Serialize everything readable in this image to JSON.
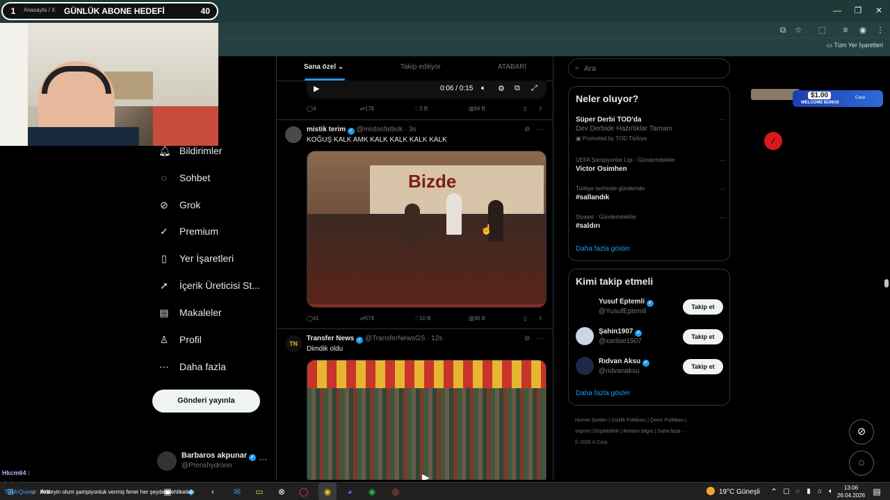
{
  "browser": {
    "tab_title": "Anasayfa / X",
    "bookmarks_label": "Tüm Yer İşaretleri"
  },
  "goal_overlay": {
    "number": "1",
    "title": "GÜNLÜK ABONE HEDEFİ",
    "count": "40"
  },
  "nav": {
    "items": [
      {
        "label": "Bildirimler",
        "icon": "bell-icon"
      },
      {
        "label": "Sohbet",
        "icon": "chat-icon"
      },
      {
        "label": "Grok",
        "icon": "grok-icon"
      },
      {
        "label": "Premium",
        "icon": "premium-icon"
      },
      {
        "label": "Yer İşaretleri",
        "icon": "bookmark-icon"
      },
      {
        "label": "İçerik Üreticisi St...",
        "icon": "rocket-icon"
      },
      {
        "label": "Makaleler",
        "icon": "article-icon"
      },
      {
        "label": "Profil",
        "icon": "person-icon"
      },
      {
        "label": "Daha fazla",
        "icon": "more-circle-icon"
      }
    ],
    "post_button": "Gönderi yayınla",
    "account": {
      "name": "Barbaros akpunar",
      "handle": "@Prenshydronn"
    }
  },
  "feed": {
    "tabs": [
      "Sana özel",
      "Takip ediliyor",
      "ATABARI"
    ],
    "video1": {
      "time": "0:06 / 0:15"
    },
    "tweet0_actions": {
      "replies": "4",
      "reposts": "178",
      "likes": "3 B",
      "views": "84 B"
    },
    "tweet1": {
      "name": "mistik terim",
      "handle": "@mistosfatbok",
      "time": "· 3s",
      "text": "KOĞUŞ KALK AMK KALK KALK KALK KALK",
      "media_text": "Bizde",
      "actions": {
        "replies": "41",
        "reposts": "574",
        "likes": "10 B",
        "views": "96 B"
      }
    },
    "tweet2": {
      "name": "Transfer News",
      "handle": "@TransferNewsGS",
      "time": "· 12s",
      "text": "Dimdik oldu",
      "avatar_text": "TN"
    }
  },
  "sidebar": {
    "search_placeholder": "Ara",
    "trends_title": "Neler oluyor?",
    "trends": [
      {
        "context": "",
        "title": "Süper Derbi TOD'da",
        "sub": "Dev Derbide Hazırlıklar Tamam",
        "promo": "Promoted by TOD Türkiye"
      },
      {
        "context": "UEFA Şampiyonlar Ligi · Gündemdekiler",
        "title": "Victor Osimhen",
        "sub": "",
        "promo": ""
      },
      {
        "context": "Türkiye tarihinde gündemde",
        "title": "#sallandık",
        "sub": "",
        "promo": ""
      },
      {
        "context": "Siyaset · Gündemdekiler",
        "title": "#saldırı",
        "sub": "",
        "promo": ""
      }
    ],
    "trends_more": "Daha fazla göster",
    "wtf_title": "Kimi takip etmeli",
    "wtf": [
      {
        "name": "Yusuf Eptemli",
        "handle": "@YusufEptemli",
        "button": "Takip et"
      },
      {
        "name": "Şahin1907",
        "handle": "@xaribie1907",
        "button": "Takip et"
      },
      {
        "name": "Rıdvan Aksu",
        "handle": "@ridvanaksu",
        "button": "Takip et"
      }
    ],
    "wtf_more": "Daha fazla göster",
    "footer_line1": "Hizmet Şartları  |  Gizlilik Politikası  |  Çerez Politikası  |",
    "footer_line2": "Imprint  |  Erişilebilirlik  |  Reklam bilgisi  |  Daha fazla ···",
    "footer_line3": "© 2026 X Corp."
  },
  "ad": {
    "amount": "$1.00",
    "label": "WELCOME BONUS",
    "brand": "Casa"
  },
  "chat": {
    "line1_user": "Hkcm64 :",
    "line2_user": "fonkurdu",
    "line3_user": "TizMcQueen :",
    "line3_text": "bekleyin olum şampiyonluk vermiş fener her şeyden tehlikelidir",
    "search_label": "Ara"
  },
  "taskbar": {
    "weather": "19°C  Güneşli",
    "time": "13:06",
    "date": "26.04.2026"
  },
  "colors": {
    "accent": "#1d9bf0",
    "chrome": "#1f3838",
    "bg": "#000000"
  }
}
